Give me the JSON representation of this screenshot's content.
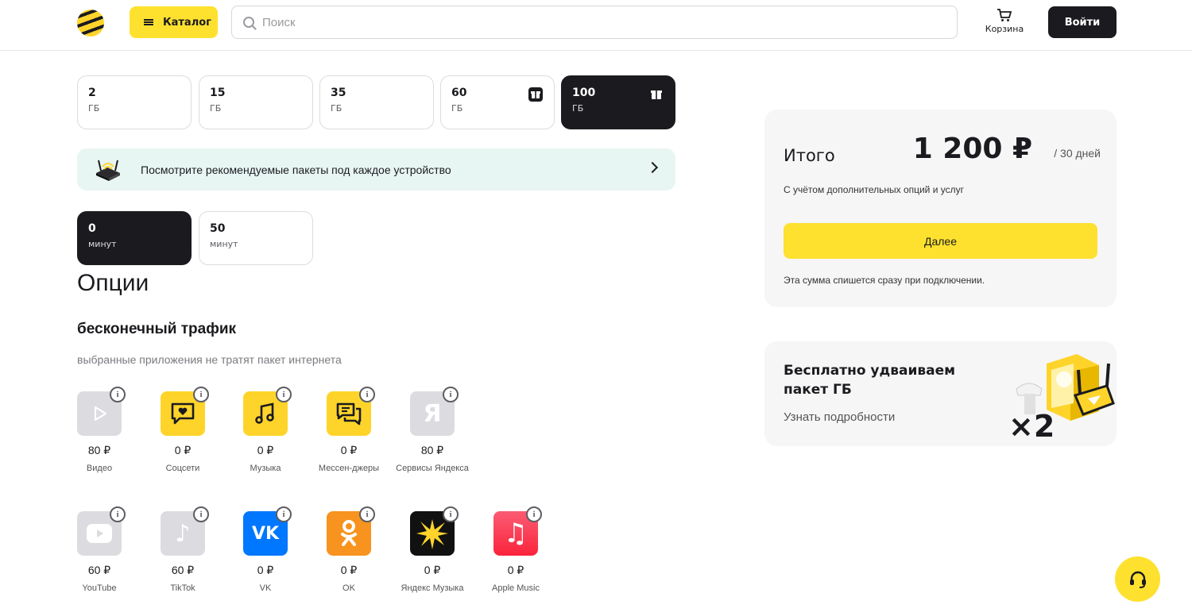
{
  "header": {
    "catalog_label": "Каталог",
    "search_placeholder": "Поиск",
    "cart_label": "Корзина",
    "login_label": "Войти"
  },
  "traffic_tiles": [
    {
      "value": "2",
      "unit": "ГБ",
      "selected": false
    },
    {
      "value": "15",
      "unit": "ГБ",
      "selected": false
    },
    {
      "value": "35",
      "unit": "ГБ",
      "selected": false
    },
    {
      "value": "60",
      "unit": "ГБ",
      "selected": false,
      "gift": true
    },
    {
      "value": "100",
      "unit": "ГБ",
      "selected": true,
      "gift": true
    }
  ],
  "banner": {
    "text": "Посмотрите рекомендуемые пакеты под каждое устройство"
  },
  "minute_tiles": [
    {
      "value": "0",
      "unit": "минут",
      "selected": true
    },
    {
      "value": "50",
      "unit": "минут",
      "selected": false
    }
  ],
  "options": {
    "title": "Опции",
    "section_title": "бесконечный трафик",
    "section_subtitle": "выбранные приложения не тратят пакет интернета",
    "info_glyph": "i",
    "apps": [
      {
        "icon": "video-play-icon",
        "price": "80 ₽",
        "label": "Видео"
      },
      {
        "icon": "social-chat-heart-icon",
        "price": "0 ₽",
        "label": "Соцсети"
      },
      {
        "icon": "music-note-icon",
        "price": "0 ₽",
        "label": "Музыка"
      },
      {
        "icon": "messenger-bubbles-icon",
        "price": "0 ₽",
        "label": "Мессен-джеры"
      },
      {
        "icon": "yandex-services-icon",
        "price": "80 ₽",
        "label": "Сервисы Яндекса",
        "glyph": "Я"
      },
      {
        "icon": "youtube-icon",
        "price": "60 ₽",
        "label": "YouTube"
      },
      {
        "icon": "tiktok-icon",
        "price": "60 ₽",
        "label": "TikTok",
        "glyph": "♪"
      },
      {
        "icon": "vk-icon",
        "price": "0 ₽",
        "label": "VK",
        "glyph": "VK"
      },
      {
        "icon": "ok-icon",
        "price": "0 ₽",
        "label": "OK"
      },
      {
        "icon": "yandex-music-icon",
        "price": "0 ₽",
        "label": "Яндекс Музыка"
      },
      {
        "icon": "apple-music-icon",
        "price": "0 ₽",
        "label": "Apple Music",
        "glyph": "♫"
      }
    ]
  },
  "summary": {
    "label": "Итого",
    "price": "1 200 ₽",
    "period": "/ 30 дней",
    "note": "С учётом дополнительных опций и услуг",
    "next_label": "Далее",
    "footnote": "Эта сумма спишется сразу при подключении."
  },
  "promo": {
    "title": "Бесплатно удваиваем пакет ГБ",
    "link": "Узнать подробности",
    "badge": "×2"
  },
  "colors": {
    "brand_yellow": "#fee12f",
    "dark": "#1b1b1f",
    "banner_bg": "#e8f6f3",
    "card_bg": "#f6f6f7"
  }
}
